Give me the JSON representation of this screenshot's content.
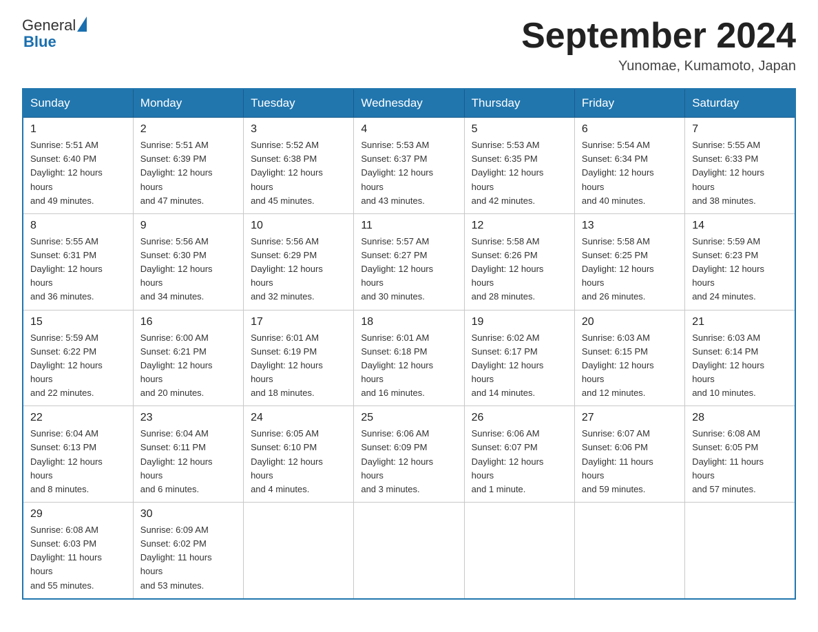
{
  "header": {
    "title": "September 2024",
    "subtitle": "Yunomae, Kumamoto, Japan",
    "logo_general": "General",
    "logo_blue": "Blue"
  },
  "weekdays": [
    "Sunday",
    "Monday",
    "Tuesday",
    "Wednesday",
    "Thursday",
    "Friday",
    "Saturday"
  ],
  "weeks": [
    [
      {
        "day": "1",
        "sunrise": "5:51 AM",
        "sunset": "6:40 PM",
        "daylight": "12 hours and 49 minutes."
      },
      {
        "day": "2",
        "sunrise": "5:51 AM",
        "sunset": "6:39 PM",
        "daylight": "12 hours and 47 minutes."
      },
      {
        "day": "3",
        "sunrise": "5:52 AM",
        "sunset": "6:38 PM",
        "daylight": "12 hours and 45 minutes."
      },
      {
        "day": "4",
        "sunrise": "5:53 AM",
        "sunset": "6:37 PM",
        "daylight": "12 hours and 43 minutes."
      },
      {
        "day": "5",
        "sunrise": "5:53 AM",
        "sunset": "6:35 PM",
        "daylight": "12 hours and 42 minutes."
      },
      {
        "day": "6",
        "sunrise": "5:54 AM",
        "sunset": "6:34 PM",
        "daylight": "12 hours and 40 minutes."
      },
      {
        "day": "7",
        "sunrise": "5:55 AM",
        "sunset": "6:33 PM",
        "daylight": "12 hours and 38 minutes."
      }
    ],
    [
      {
        "day": "8",
        "sunrise": "5:55 AM",
        "sunset": "6:31 PM",
        "daylight": "12 hours and 36 minutes."
      },
      {
        "day": "9",
        "sunrise": "5:56 AM",
        "sunset": "6:30 PM",
        "daylight": "12 hours and 34 minutes."
      },
      {
        "day": "10",
        "sunrise": "5:56 AM",
        "sunset": "6:29 PM",
        "daylight": "12 hours and 32 minutes."
      },
      {
        "day": "11",
        "sunrise": "5:57 AM",
        "sunset": "6:27 PM",
        "daylight": "12 hours and 30 minutes."
      },
      {
        "day": "12",
        "sunrise": "5:58 AM",
        "sunset": "6:26 PM",
        "daylight": "12 hours and 28 minutes."
      },
      {
        "day": "13",
        "sunrise": "5:58 AM",
        "sunset": "6:25 PM",
        "daylight": "12 hours and 26 minutes."
      },
      {
        "day": "14",
        "sunrise": "5:59 AM",
        "sunset": "6:23 PM",
        "daylight": "12 hours and 24 minutes."
      }
    ],
    [
      {
        "day": "15",
        "sunrise": "5:59 AM",
        "sunset": "6:22 PM",
        "daylight": "12 hours and 22 minutes."
      },
      {
        "day": "16",
        "sunrise": "6:00 AM",
        "sunset": "6:21 PM",
        "daylight": "12 hours and 20 minutes."
      },
      {
        "day": "17",
        "sunrise": "6:01 AM",
        "sunset": "6:19 PM",
        "daylight": "12 hours and 18 minutes."
      },
      {
        "day": "18",
        "sunrise": "6:01 AM",
        "sunset": "6:18 PM",
        "daylight": "12 hours and 16 minutes."
      },
      {
        "day": "19",
        "sunrise": "6:02 AM",
        "sunset": "6:17 PM",
        "daylight": "12 hours and 14 minutes."
      },
      {
        "day": "20",
        "sunrise": "6:03 AM",
        "sunset": "6:15 PM",
        "daylight": "12 hours and 12 minutes."
      },
      {
        "day": "21",
        "sunrise": "6:03 AM",
        "sunset": "6:14 PM",
        "daylight": "12 hours and 10 minutes."
      }
    ],
    [
      {
        "day": "22",
        "sunrise": "6:04 AM",
        "sunset": "6:13 PM",
        "daylight": "12 hours and 8 minutes."
      },
      {
        "day": "23",
        "sunrise": "6:04 AM",
        "sunset": "6:11 PM",
        "daylight": "12 hours and 6 minutes."
      },
      {
        "day": "24",
        "sunrise": "6:05 AM",
        "sunset": "6:10 PM",
        "daylight": "12 hours and 4 minutes."
      },
      {
        "day": "25",
        "sunrise": "6:06 AM",
        "sunset": "6:09 PM",
        "daylight": "12 hours and 3 minutes."
      },
      {
        "day": "26",
        "sunrise": "6:06 AM",
        "sunset": "6:07 PM",
        "daylight": "12 hours and 1 minute."
      },
      {
        "day": "27",
        "sunrise": "6:07 AM",
        "sunset": "6:06 PM",
        "daylight": "11 hours and 59 minutes."
      },
      {
        "day": "28",
        "sunrise": "6:08 AM",
        "sunset": "6:05 PM",
        "daylight": "11 hours and 57 minutes."
      }
    ],
    [
      {
        "day": "29",
        "sunrise": "6:08 AM",
        "sunset": "6:03 PM",
        "daylight": "11 hours and 55 minutes."
      },
      {
        "day": "30",
        "sunrise": "6:09 AM",
        "sunset": "6:02 PM",
        "daylight": "11 hours and 53 minutes."
      },
      null,
      null,
      null,
      null,
      null
    ]
  ],
  "labels": {
    "sunrise": "Sunrise:",
    "sunset": "Sunset:",
    "daylight": "Daylight:"
  }
}
